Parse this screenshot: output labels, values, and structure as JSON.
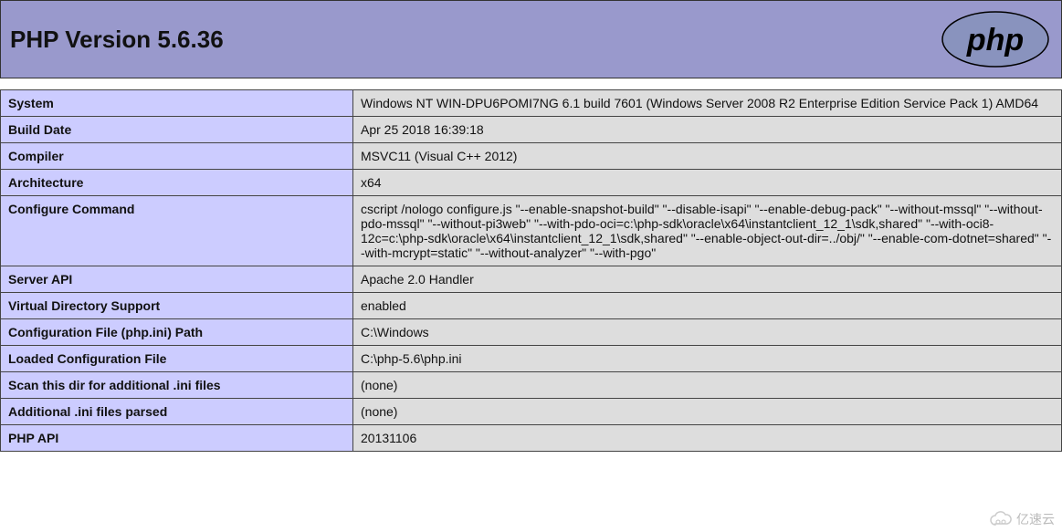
{
  "header": {
    "title": "PHP Version 5.6.36",
    "logo_text": "php"
  },
  "info": {
    "rows": [
      {
        "key": "System",
        "value": "Windows NT WIN-DPU6POMI7NG 6.1 build 7601 (Windows Server 2008 R2 Enterprise Edition Service Pack 1) AMD64"
      },
      {
        "key": "Build Date",
        "value": "Apr 25 2018 16:39:18"
      },
      {
        "key": "Compiler",
        "value": "MSVC11 (Visual C++ 2012)"
      },
      {
        "key": "Architecture",
        "value": "x64"
      },
      {
        "key": "Configure Command",
        "value": "cscript /nologo configure.js \"--enable-snapshot-build\" \"--disable-isapi\" \"--enable-debug-pack\" \"--without-mssql\" \"--without-pdo-mssql\" \"--without-pi3web\" \"--with-pdo-oci=c:\\php-sdk\\oracle\\x64\\instantclient_12_1\\sdk,shared\" \"--with-oci8-12c=c:\\php-sdk\\oracle\\x64\\instantclient_12_1\\sdk,shared\" \"--enable-object-out-dir=../obj/\" \"--enable-com-dotnet=shared\" \"--with-mcrypt=static\" \"--without-analyzer\" \"--with-pgo\""
      },
      {
        "key": "Server API",
        "value": "Apache 2.0 Handler"
      },
      {
        "key": "Virtual Directory Support",
        "value": "enabled"
      },
      {
        "key": "Configuration File (php.ini) Path",
        "value": "C:\\Windows"
      },
      {
        "key": "Loaded Configuration File",
        "value": "C:\\php-5.6\\php.ini"
      },
      {
        "key": "Scan this dir for additional .ini files",
        "value": "(none)"
      },
      {
        "key": "Additional .ini files parsed",
        "value": "(none)"
      },
      {
        "key": "PHP API",
        "value": "20131106"
      }
    ]
  },
  "watermark": {
    "text": "亿速云"
  }
}
